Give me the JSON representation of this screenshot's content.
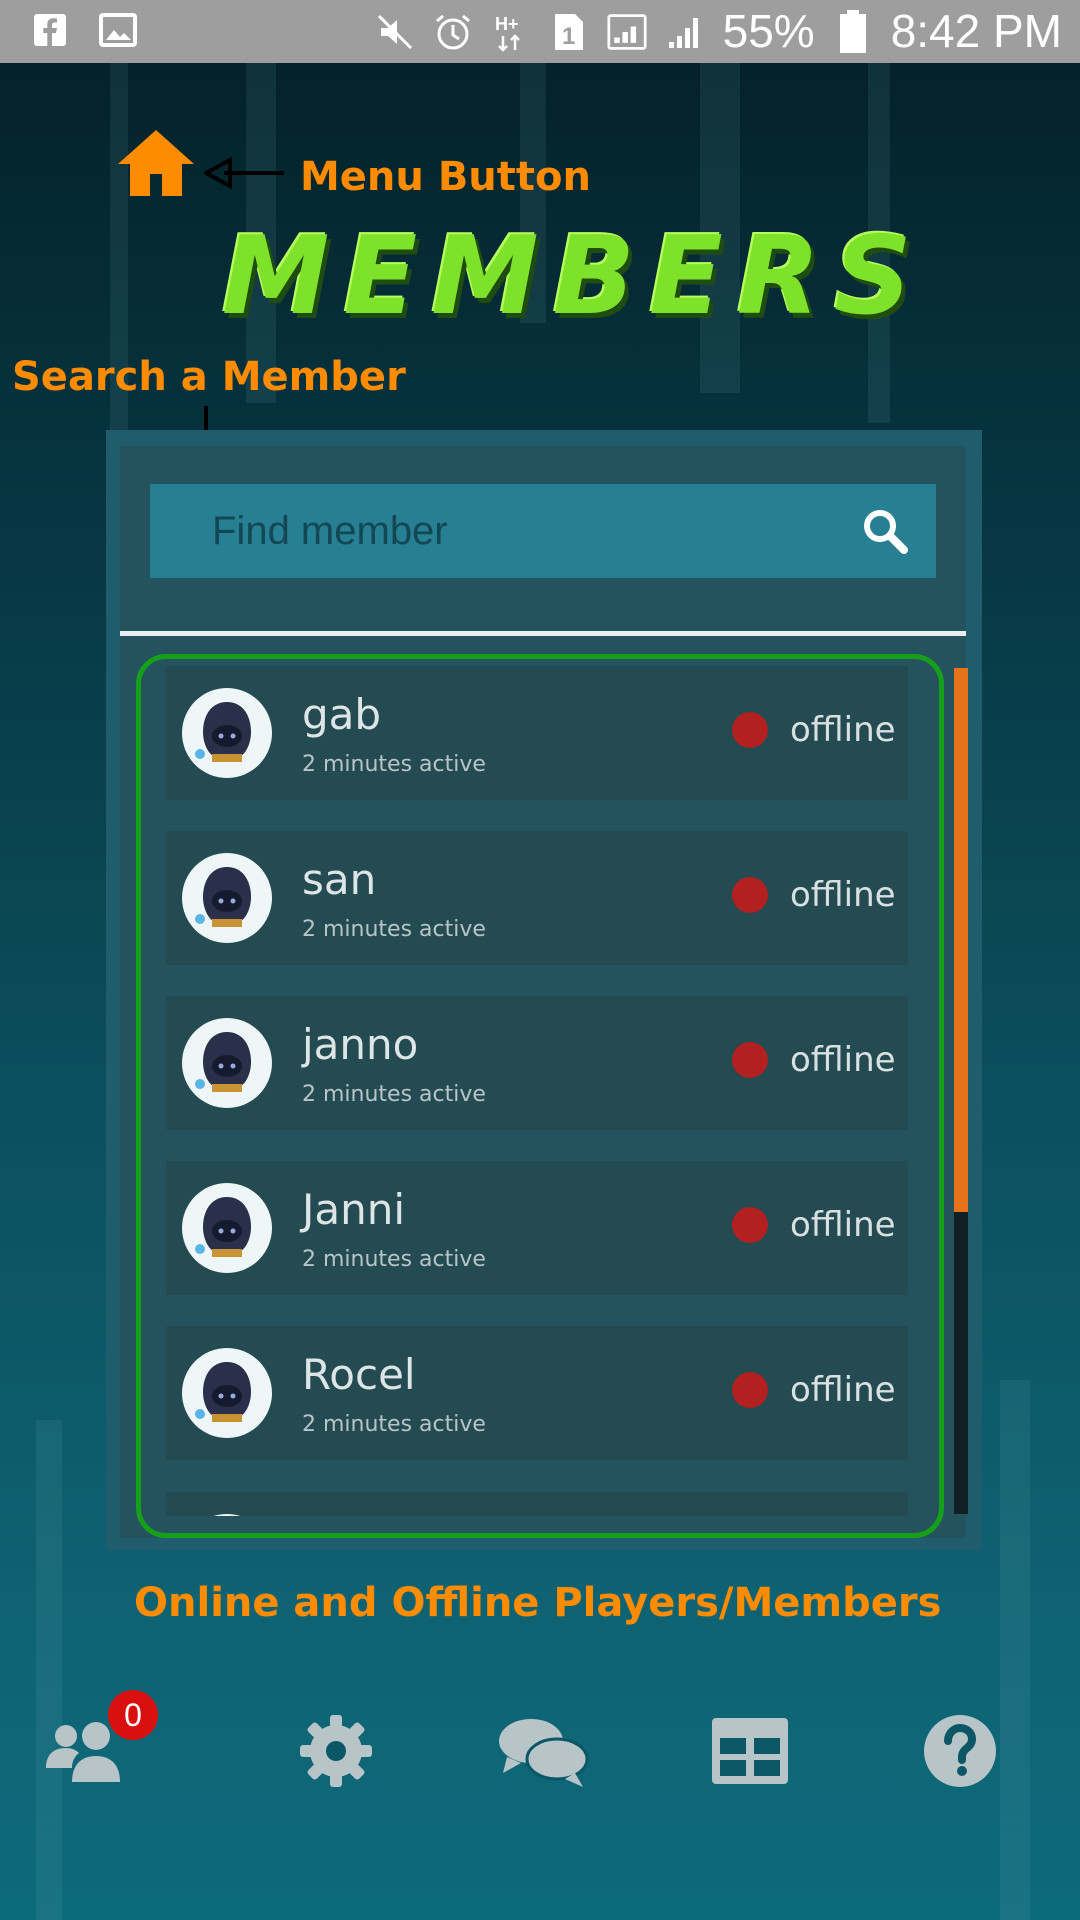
{
  "status_bar": {
    "battery": "55%",
    "time": "8:42 PM"
  },
  "annotations": {
    "menu": "Menu Button",
    "search": "Search a Member",
    "list": "Online and Offline  Players/Members"
  },
  "title": "MEMBERS",
  "search": {
    "placeholder": "Find member"
  },
  "members": [
    {
      "name": "gab",
      "active": "2 minutes active",
      "status": "offline"
    },
    {
      "name": "san",
      "active": "2 minutes active",
      "status": "offline"
    },
    {
      "name": "janno",
      "active": "2 minutes active",
      "status": "offline"
    },
    {
      "name": "Janni",
      "active": "2 minutes active",
      "status": "offline"
    },
    {
      "name": "Rocel",
      "active": "2 minutes active",
      "status": "offline"
    }
  ],
  "nav": {
    "badge": "0"
  },
  "colors": {
    "accent": "#ff8c00",
    "title": "#7ee22a",
    "offline": "#b2201f",
    "frame": "#16a01a"
  }
}
